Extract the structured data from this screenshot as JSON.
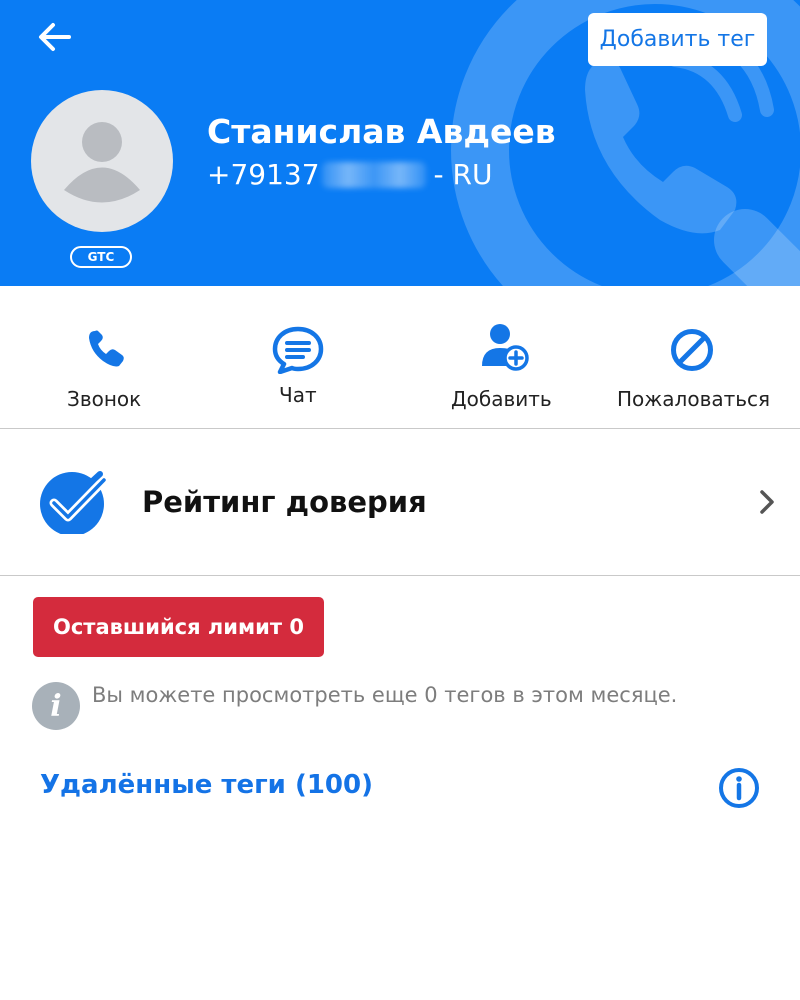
{
  "header": {
    "add_tag_label": "Добавить тег",
    "name": "Станислав Авдеев",
    "phone_prefix": "+79137",
    "phone_suffix": "- RU",
    "badge": "GTC"
  },
  "actions": [
    {
      "label": "Звонок",
      "icon": "phone-icon"
    },
    {
      "label": "Чат",
      "icon": "chat-icon"
    },
    {
      "label": "Добавить",
      "icon": "add-contact-icon"
    },
    {
      "label": "Пожаловаться",
      "icon": "block-icon"
    }
  ],
  "trust": {
    "label": "Рейтинг доверия"
  },
  "limit": {
    "label": "Оставшийся лимит 0",
    "info_text": "Вы можете просмотреть еще 0 тегов в этом месяце."
  },
  "deleted_tags": {
    "label": "Удалённые теги (100)"
  },
  "colors": {
    "header_blue": "#0a7cf4",
    "accent_blue": "#1476e6",
    "limit_red": "#d42b3d",
    "muted_gray": "#a8b1b9"
  }
}
